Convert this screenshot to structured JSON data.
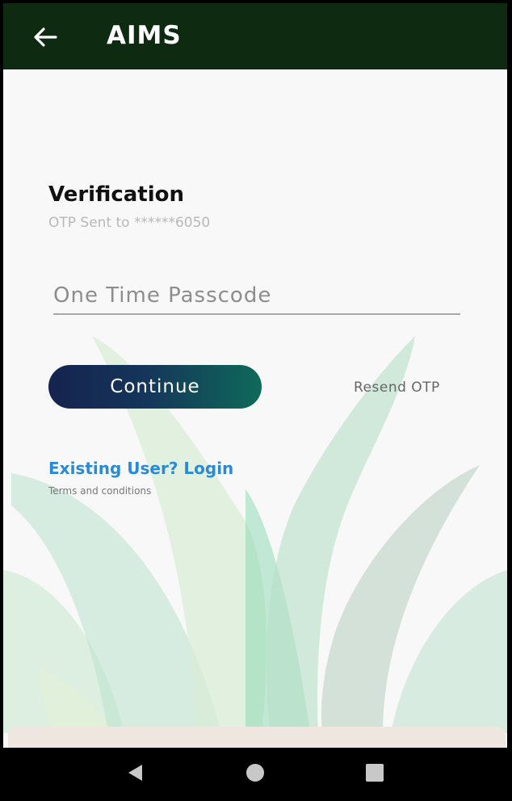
{
  "appbar": {
    "title": "AIMS",
    "back_icon": "arrow-left-icon"
  },
  "verification": {
    "heading": "Verification",
    "subtext": "OTP Sent to ******6050",
    "otp_placeholder": "One Time Passcode",
    "otp_value": "",
    "continue_label": "Continue",
    "resend_label": "Resend OTP",
    "login_label": "Existing User? Login",
    "terms_label": "Terms and conditions"
  },
  "navbar": {
    "back_icon": "triangle-back-icon",
    "home_icon": "circle-home-icon",
    "recents_icon": "square-recents-icon"
  },
  "colors": {
    "appbar": "#0e2a10",
    "button_start": "#15234f",
    "button_end": "#0f6a5a",
    "link": "#2a8ad6",
    "leaf": "#7fd3aa"
  }
}
